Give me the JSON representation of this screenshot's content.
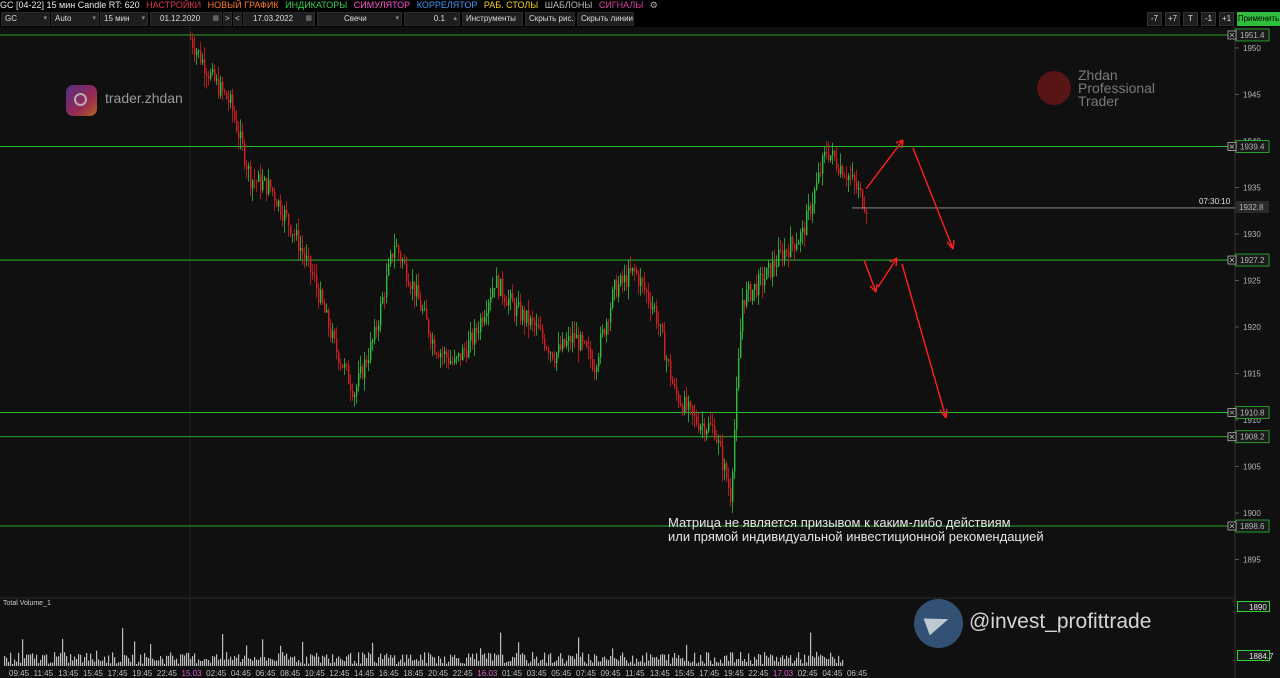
{
  "menubar": {
    "symbol": "GC [04-22] 15 мин Candle RT: 620",
    "items": [
      {
        "label": "НАСТРОЙКИ",
        "color": "#e0304a"
      },
      {
        "label": "НОВЫЙ ГРАФИК",
        "color": "#ff7a1a"
      },
      {
        "label": "ИНДИКАТОРЫ",
        "color": "#2fd24a"
      },
      {
        "label": "СИМУЛЯТОР",
        "color": "#ff4fd6"
      },
      {
        "label": "КОРРЕЛЯТОР",
        "color": "#3a9cff"
      },
      {
        "label": "РАБ. СТОЛЫ",
        "color": "#ffd21a"
      },
      {
        "label": "ШАБЛОНЫ",
        "color": "#bdbdbd"
      },
      {
        "label": "СИГНАЛЫ",
        "color": "#e03ea8"
      }
    ]
  },
  "toolbar": {
    "instrument": "GC",
    "scale": "Auto",
    "timeframe": "15 мин",
    "date_from": "01.12.2020",
    "date_to": "17.03.2022",
    "chart_type": "Свечи",
    "step": "0.1",
    "tools_label": "Инструменты",
    "hide_drawings_label": "Скрыть рис.",
    "hide_lines_label": "Скрыть линии",
    "right_buttons": [
      "-7",
      "+7",
      "T",
      "-1",
      "+1"
    ],
    "apply_label": "Применить"
  },
  "watermarks": {
    "instagram": "trader.zhdan",
    "youtube_lines": [
      "Zhdan",
      "Professional",
      "Trader"
    ],
    "telegram": "@invest_profittrade"
  },
  "disclaimer": {
    "line1": "Матрица не является призывом к каким-либо действиям",
    "line2": "или прямой индивидуальной инвестиционной рекомендацией"
  },
  "chart_data": {
    "type": "candlestick",
    "y_axis_ticks": [
      1950,
      1945,
      1940,
      1935,
      1930,
      1925,
      1920,
      1915,
      1910,
      1905,
      1900,
      1895
    ],
    "ylim": [
      1893,
      1953
    ],
    "levels": [
      1951.4,
      1939.4,
      1927.2,
      1910.8,
      1908.2,
      1898.6
    ],
    "level_labels": [
      "1951.4",
      "1939.4",
      "1927.2",
      "1910.8",
      "1908.2",
      "1898.6"
    ],
    "current_price": 1932.8,
    "current_price_label": "1932.8",
    "timer": "07:30:10",
    "volume_title": "Total Volume_1",
    "volume_levels": [
      "1890",
      "1884.7"
    ],
    "x_labels": [
      "09:45",
      "11:45",
      "13:45",
      "15:45",
      "17:45",
      "19:45",
      "22:45",
      "15.03",
      "02:45",
      "04:45",
      "06:45",
      "08:45",
      "10:45",
      "12:45",
      "14:45",
      "16:45",
      "18:45",
      "20:45",
      "22:45",
      "16.03",
      "01:45",
      "03:45",
      "05:45",
      "07:45",
      "09:45",
      "11:45",
      "13:45",
      "15:45",
      "17:45",
      "19:45",
      "22:45",
      "17.03",
      "02:45",
      "04:45",
      "06:45"
    ],
    "path_anchors": [
      [
        0,
        1951
      ],
      [
        10,
        1947
      ],
      [
        20,
        1944
      ],
      [
        30,
        1936
      ],
      [
        40,
        1935
      ],
      [
        52,
        1930
      ],
      [
        62,
        1925
      ],
      [
        72,
        1918
      ],
      [
        82,
        1913
      ],
      [
        92,
        1919
      ],
      [
        102,
        1929
      ],
      [
        112,
        1924
      ],
      [
        122,
        1918
      ],
      [
        132,
        1916
      ],
      [
        142,
        1919
      ],
      [
        152,
        1925
      ],
      [
        162,
        1922
      ],
      [
        172,
        1920
      ],
      [
        182,
        1917
      ],
      [
        192,
        1919
      ],
      [
        202,
        1916
      ],
      [
        212,
        1924
      ],
      [
        222,
        1926
      ],
      [
        232,
        1922
      ],
      [
        242,
        1913
      ],
      [
        252,
        1910
      ],
      [
        262,
        1909
      ],
      [
        270,
        1902
      ],
      [
        276,
        1923
      ],
      [
        286,
        1925
      ],
      [
        296,
        1928
      ],
      [
        306,
        1930
      ],
      [
        318,
        1939
      ],
      [
        330,
        1936
      ],
      [
        338,
        1933
      ]
    ]
  },
  "colors": {
    "up": "#2fbf3a",
    "down": "#d42020",
    "level_line": "#2cd82c",
    "arrow": "#ff2020",
    "background": "#101010"
  }
}
